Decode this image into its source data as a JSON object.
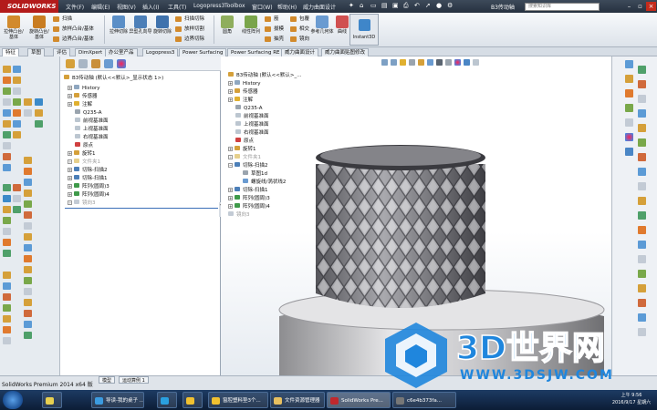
{
  "app": {
    "logo_text": "SOLIDWORKS",
    "menu": [
      "文件(F)",
      "编辑(E)",
      "视图(V)",
      "插入(I)",
      "工具(T)",
      "Logopress3",
      "Toolbox",
      "窗口(W)",
      "帮助(H)",
      "威力曲面设计"
    ],
    "doc_title": "B3传动轴",
    "search_placeholder": "搜索知识库"
  },
  "ribbon": {
    "big_buttons": [
      "拉伸凸台/基体",
      "旋转凸台/基体",
      "拉伸切除",
      "异型孔向导",
      "旋转切除",
      "圆角",
      "线性阵列",
      "参考几何体",
      "曲线"
    ],
    "small_buttons": [
      "扫描",
      "放样凸台/基体",
      "边界凸台/基体",
      "扫描切除",
      "放样切割",
      "边界切除",
      "筋",
      "拔模",
      "抽壳",
      "包覆",
      "相交",
      "镜向"
    ],
    "instant3d": "Instant3D"
  },
  "tabs": [
    "特征",
    "草图",
    "评估",
    "DimXpert",
    "办公室产品",
    "Logopress3",
    "Power Surfacing",
    "Power Surfacing RE",
    "威力曲面设计",
    "威力曲面贴图修改"
  ],
  "tree": {
    "root": "B3传动轴 (默认<<默认>_显示状态 1>)",
    "items": [
      "History",
      "传感器",
      "注解",
      "Q235-A",
      "前视基准面",
      "上视基准面",
      "右视基准面",
      "原点",
      "旋转1",
      "文件夹1",
      "切除-扫描2",
      "切除-扫描1",
      "阵列(圆周)3",
      "阵列(圆周)4",
      "镜向3"
    ]
  },
  "view_tree": {
    "root": "B3传动轴 (默认<<默认>_...",
    "items": [
      "History",
      "传感器",
      "注解",
      "Q235-A",
      "前视基准面",
      "上视基准面",
      "右视基准面",
      "原点",
      "旋转1",
      "文件夹1",
      "切除-扫描2",
      "草图1d",
      "螺旋线/涡状线2",
      "切除-扫描1",
      "阵列(圆周)3",
      "阵列(圆周)4",
      "镜向3"
    ]
  },
  "statusbar": {
    "text": "SolidWorks Premium 2014 x64 版",
    "tabs": [
      "模型",
      "运动算例 1"
    ]
  },
  "taskbar": {
    "items": [
      "导读-我的桌子 ...",
      "",
      "",
      "窗腔塑料垫3个...",
      "文件资源管理器",
      "SolidWorks Pre...",
      "c6e4b373fa..."
    ],
    "time": "上午 9:56",
    "date": "2016/9/17 星期六"
  },
  "watermark": {
    "logo_text": "3D世界网",
    "url": "WWW.3DSJW.COM"
  },
  "colors": {
    "accent": "#1a7fd6",
    "logo_red": "#b31b1b",
    "ribbon_orange": "#d28a2c",
    "watermark_blue": "#1f86dd"
  }
}
